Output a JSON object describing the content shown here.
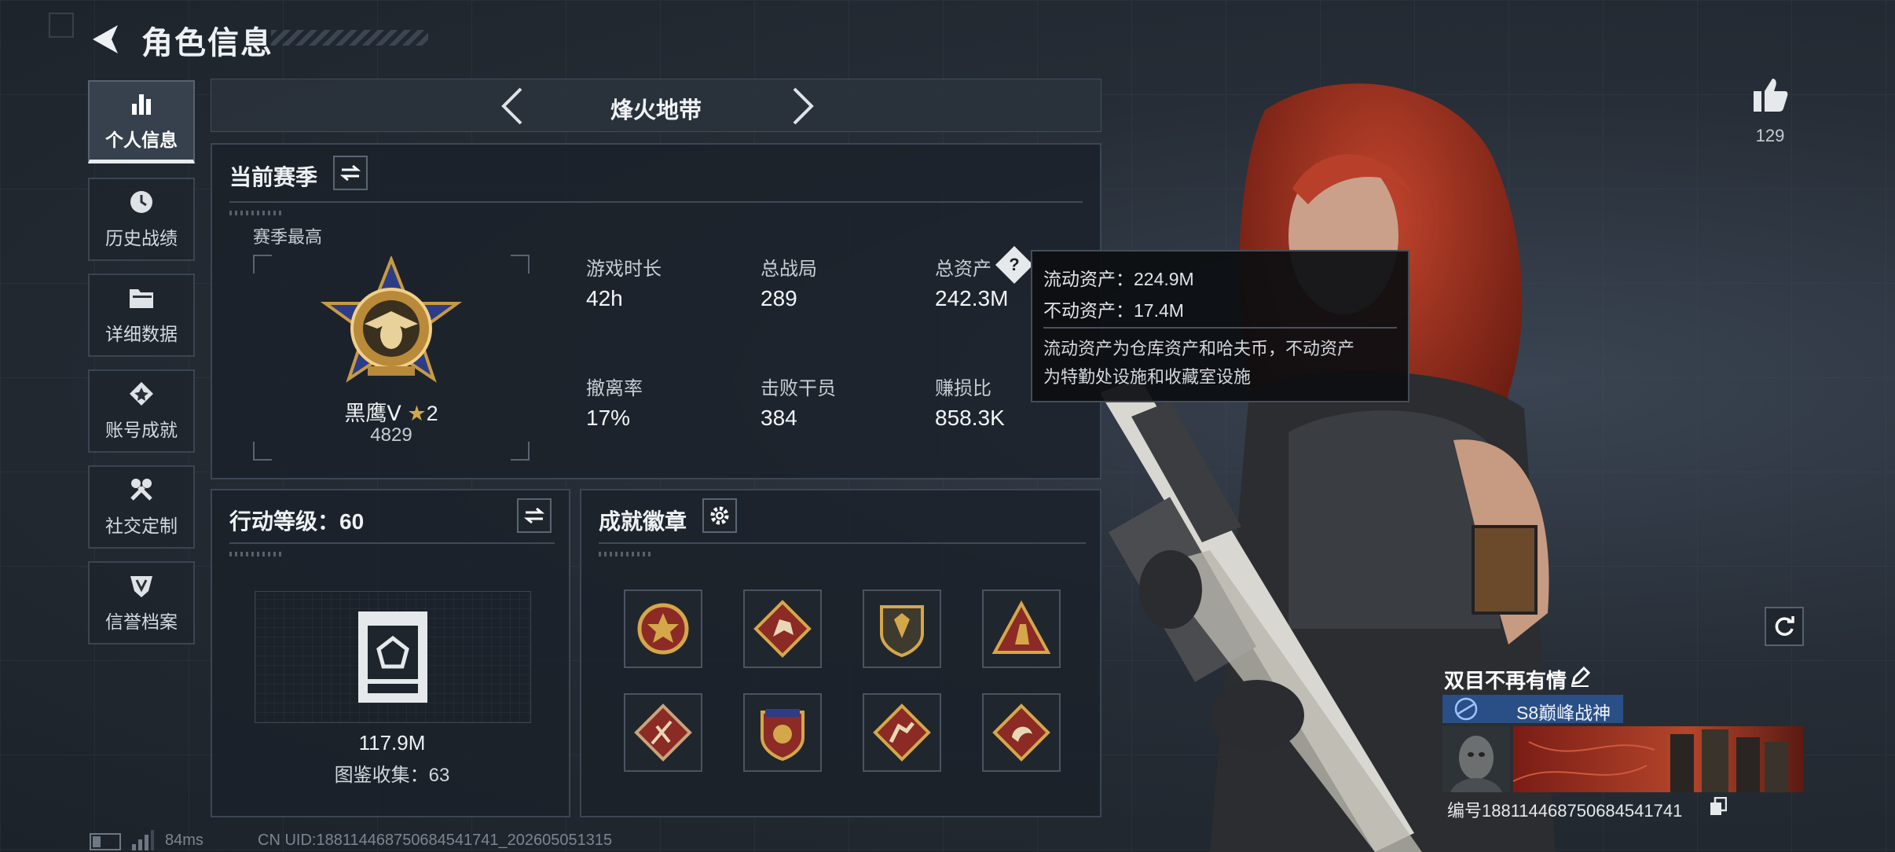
{
  "header": {
    "title": "角色信息"
  },
  "nav": [
    {
      "label": "个人信息",
      "icon": "bar-chart-icon",
      "active": true
    },
    {
      "label": "历史战绩",
      "icon": "clock-icon",
      "active": false
    },
    {
      "label": "详细数据",
      "icon": "folder-icon",
      "active": false
    },
    {
      "label": "账号成就",
      "icon": "medal-icon",
      "active": false
    },
    {
      "label": "社交定制",
      "icon": "tools-icon",
      "active": false
    },
    {
      "label": "信誉档案",
      "icon": "shield-icon",
      "active": false
    }
  ],
  "mode": {
    "label": "烽火地带"
  },
  "season": {
    "title": "当前赛季",
    "best_label": "赛季最高",
    "rank_name": "黑鹰Ⅴ",
    "rank_stars": "2",
    "rank_score": "4829",
    "stats": [
      {
        "label": "游戏时长",
        "value": "42h"
      },
      {
        "label": "总战局",
        "value": "289"
      },
      {
        "label": "总资产",
        "value": "242.3M"
      },
      {
        "label": "撤离率",
        "value": "17%"
      },
      {
        "label": "击败干员",
        "value": "384"
      },
      {
        "label": "赚损比",
        "value": "858.3K"
      }
    ]
  },
  "tooltip": {
    "liquid": "流动资产：224.9M",
    "fixed": "不动资产：17.4M",
    "desc_line1": "流动资产为仓库资产和哈夫币，不动资产",
    "desc_line2": "为特勤处设施和收藏室设施"
  },
  "action_level": {
    "title": "行动等级：60",
    "value": "117.9M",
    "collection": "图鉴收集：63"
  },
  "achievements": {
    "title": "成就徽章"
  },
  "likes": {
    "count": "129"
  },
  "player": {
    "name": "双目不再有情",
    "title": "S8巅峰战神",
    "id": "编号1881144687506845417​41"
  },
  "status": {
    "ping": "84ms",
    "uid": "CN UID:1881144687506845417​41_202605051315"
  },
  "colors": {
    "accent_gold": "#d4a74a",
    "badge_red": "#8c2a25",
    "title_bar_blue": "#2a4f86"
  }
}
